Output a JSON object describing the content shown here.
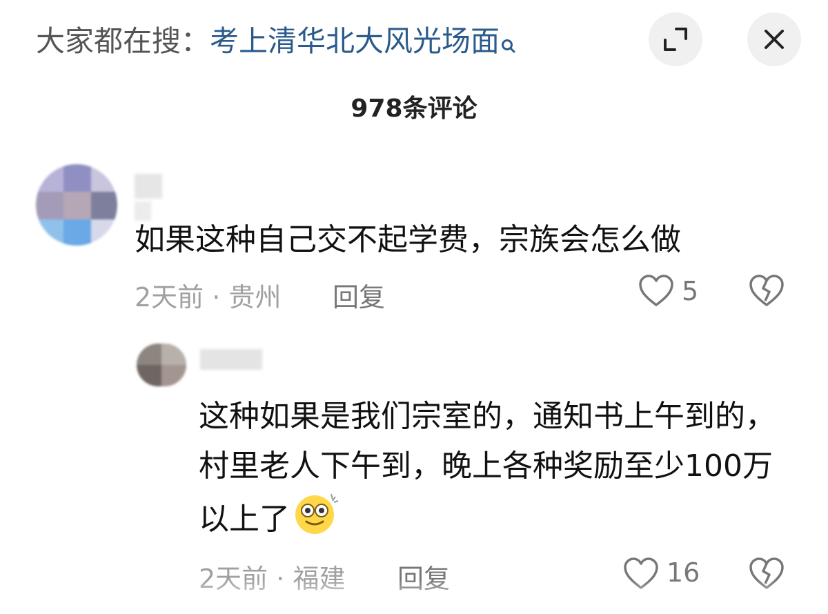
{
  "header": {
    "search_prefix": "大家都在搜：",
    "search_term": "考上清华北大风光场面",
    "comment_count": "978条评论"
  },
  "comments": [
    {
      "text": "如果这种自己交不起学费，宗族会怎么做",
      "time": "2天前",
      "location": "贵州",
      "reply_label": "回复",
      "likes": "5"
    },
    {
      "text": "这种如果是我们宗室的，通知书上午到的，村里老人下午到，晚上各种奖励至少100万以上了",
      "time": "2天前",
      "location": "福建",
      "reply_label": "回复",
      "likes": "16"
    }
  ]
}
